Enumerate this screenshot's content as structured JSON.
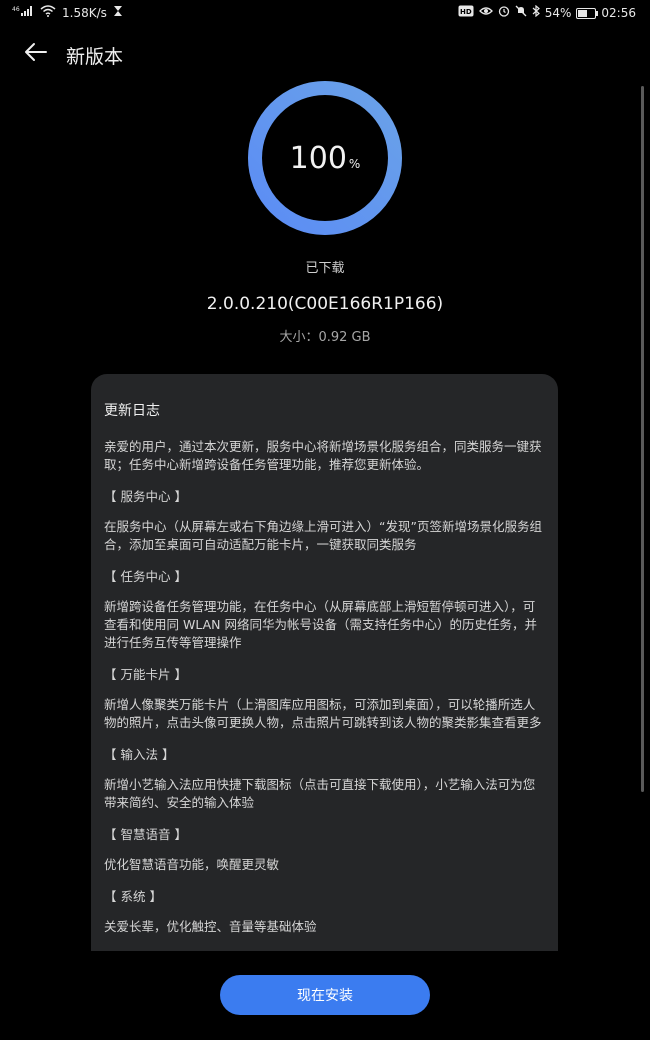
{
  "status_bar": {
    "signal": "⁴⁶ᵢₗₗ",
    "net_speed": "1.58K/s",
    "battery_percent": "54%",
    "battery_level": 0.54,
    "time": "02:56",
    "hd_badge": "HD"
  },
  "header": {
    "title": "新版本"
  },
  "progress": {
    "value": "100",
    "unit": "%",
    "fraction": 1.0,
    "status": "已下载",
    "color_start": "#5b8cf5",
    "color_end": "#6aa2e8"
  },
  "package": {
    "version": "2.0.0.210(C00E166R1P166)",
    "size": "大小：0.92 GB"
  },
  "changelog": {
    "title": "更新日志",
    "intro": "亲爱的用户，通过本次更新，服务中心将新增场景化服务组合，同类服务一键获取；任务中心新增跨设备任务管理功能，推荐您更新体验。",
    "sections": [
      {
        "heading": "【 服务中心 】",
        "body": "在服务中心（从屏幕左或右下角边缘上滑可进入）“发现”页签新增场景化服务组合，添加至桌面可自动适配万能卡片，一键获取同类服务"
      },
      {
        "heading": "【 任务中心 】",
        "body": "新增跨设备任务管理功能，在任务中心（从屏幕底部上滑短暂停顿可进入），可查看和使用同 WLAN 网络同华为帐号设备（需支持任务中心）的历史任务，并进行任务互传等管理操作"
      },
      {
        "heading": "【 万能卡片 】",
        "body": "新增人像聚类万能卡片（上滑图库应用图标，可添加到桌面），可以轮播所选人物的照片，点击头像可更换人物，点击照片可跳转到该人物的聚类影集查看更多"
      },
      {
        "heading": "【 输入法 】",
        "body": "新增小艺输入法应用快捷下载图标（点击可直接下载使用），小艺输入法可为您带来简约、安全的输入体验"
      },
      {
        "heading": "【 智慧语音 】",
        "body": "优化智慧语音功能，唤醒更灵敏"
      },
      {
        "heading": "【 系统 】",
        "body": "关爱长辈，优化触控、音量等基础体验"
      }
    ]
  },
  "actions": {
    "install_label": "现在安装",
    "accent_color": "#3b7cf0"
  }
}
